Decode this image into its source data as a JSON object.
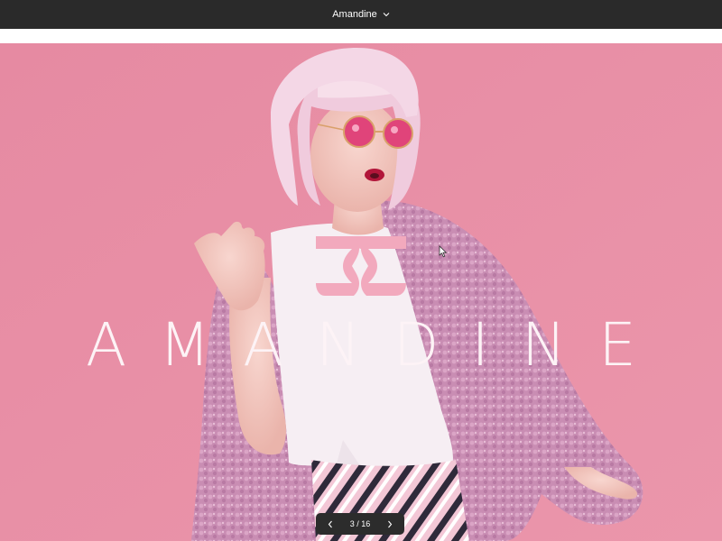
{
  "header": {
    "title": "Amandine",
    "dropdown_icon": "chevron-down-icon"
  },
  "slide": {
    "wordmark": "AMANDINE",
    "logo": "amandine-logo-mark",
    "background_color": "#e98aa3",
    "accent_color": "#f2a9bd"
  },
  "pager": {
    "current": "3",
    "separator": "/",
    "total": "16",
    "label": "3 / 16",
    "prev_icon": "chevron-left-icon",
    "next_icon": "chevron-right-icon"
  }
}
